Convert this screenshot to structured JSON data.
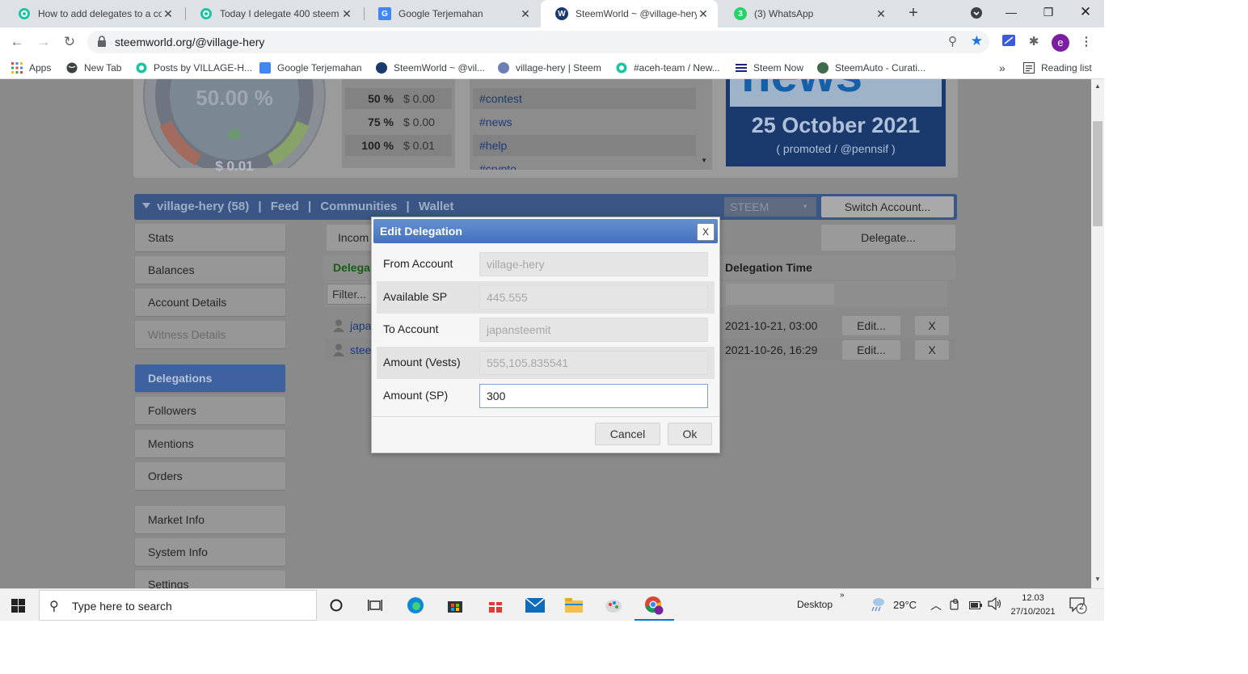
{
  "browser": {
    "tabs": [
      {
        "title": "How to add delegates to a co",
        "active": false,
        "icon": "steemit-icon"
      },
      {
        "title": "Today I delegate 400 steem to",
        "active": false,
        "icon": "steemit-icon"
      },
      {
        "title": "Google Terjemahan",
        "active": false,
        "icon": "google-translate-icon"
      },
      {
        "title": "SteemWorld ~ @village-hery",
        "active": true,
        "icon": "steemworld-icon"
      },
      {
        "title": "(3) WhatsApp",
        "active": false,
        "icon": "whatsapp-icon",
        "badge": "3"
      }
    ],
    "address": "steemworld.org/@village-hery",
    "profile_initial": "e",
    "bookmarks": [
      {
        "label": "Apps",
        "icon": "apps-grid-icon"
      },
      {
        "label": "New Tab",
        "icon": "globe-icon"
      },
      {
        "label": "Posts by VILLAGE-H...",
        "icon": "steemit-icon"
      },
      {
        "label": "Google Terjemahan",
        "icon": "google-translate-icon"
      },
      {
        "label": "SteemWorld ~ @vil...",
        "icon": "steemworld-icon"
      },
      {
        "label": "village-hery | Steem",
        "icon": "steemworld-icon"
      },
      {
        "label": "#aceh-team / New...",
        "icon": "steemit-icon"
      },
      {
        "label": "Steem Now",
        "icon": "list-icon"
      },
      {
        "label": "SteemAuto - Curati...",
        "icon": "steemauto-icon"
      }
    ],
    "bookmarks_more": "»",
    "reading_list": "Reading list"
  },
  "page": {
    "gauge": {
      "percent_text": "50.00 %",
      "value": "$ 0.01"
    },
    "vote_values": [
      {
        "pct": "50 %",
        "usd": "$ 0.00"
      },
      {
        "pct": "75 %",
        "usd": "$ 0.00"
      },
      {
        "pct": "100 %",
        "usd": "$ 0.01"
      }
    ],
    "tags": [
      "#contest",
      "#news",
      "#help",
      "#crypto"
    ],
    "news": {
      "title_partial": "news",
      "date": "25 October 2021",
      "promo": "( promoted / @pennsif )"
    },
    "navbar": {
      "account": "village-hery (58)",
      "links": [
        "Feed",
        "Communities",
        "Wallet"
      ],
      "separator": "|",
      "currency": "STEEM",
      "switch_label": "Switch Account..."
    },
    "sidebar": [
      {
        "label": "Stats",
        "state": "normal"
      },
      {
        "label": "Balances",
        "state": "normal"
      },
      {
        "label": "Account Details",
        "state": "normal"
      },
      {
        "label": "Witness Details",
        "state": "dim"
      },
      {
        "label": "Delegations",
        "state": "active"
      },
      {
        "label": "Followers",
        "state": "normal"
      },
      {
        "label": "Mentions",
        "state": "normal"
      },
      {
        "label": "Orders",
        "state": "normal"
      },
      {
        "label": "Market Info",
        "state": "normal"
      },
      {
        "label": "System Info",
        "state": "normal"
      },
      {
        "label": "Settings",
        "state": "normal"
      }
    ],
    "delegations": {
      "incoming_tab": "Incom",
      "delegate_button": "Delegate...",
      "col_delegatee": "Delega",
      "col_time": "Delegation Time",
      "filter_placeholder": "Filter...",
      "rows": [
        {
          "name": "japa",
          "time": "2021-10-21, 03:00",
          "edit": "Edit...",
          "remove": "X"
        },
        {
          "name": "stee",
          "time": "2021-10-26, 16:29",
          "edit": "Edit...",
          "remove": "X"
        }
      ]
    }
  },
  "modal": {
    "title": "Edit Delegation",
    "close": "X",
    "fields": [
      {
        "label": "From Account",
        "value": "village-hery"
      },
      {
        "label": "Available SP",
        "value": "445.555"
      },
      {
        "label": "To Account",
        "value": "japansteemit"
      },
      {
        "label": "Amount (Vests)",
        "value": "555,105.835541"
      },
      {
        "label": "Amount (SP)",
        "value": "300"
      }
    ],
    "cancel": "Cancel",
    "ok": "Ok"
  },
  "taskbar": {
    "search_placeholder": "Type here to search",
    "desktop": "Desktop",
    "weather": "29°C",
    "time": "12.03",
    "date": "27/10/2021",
    "notifications": "2"
  }
}
